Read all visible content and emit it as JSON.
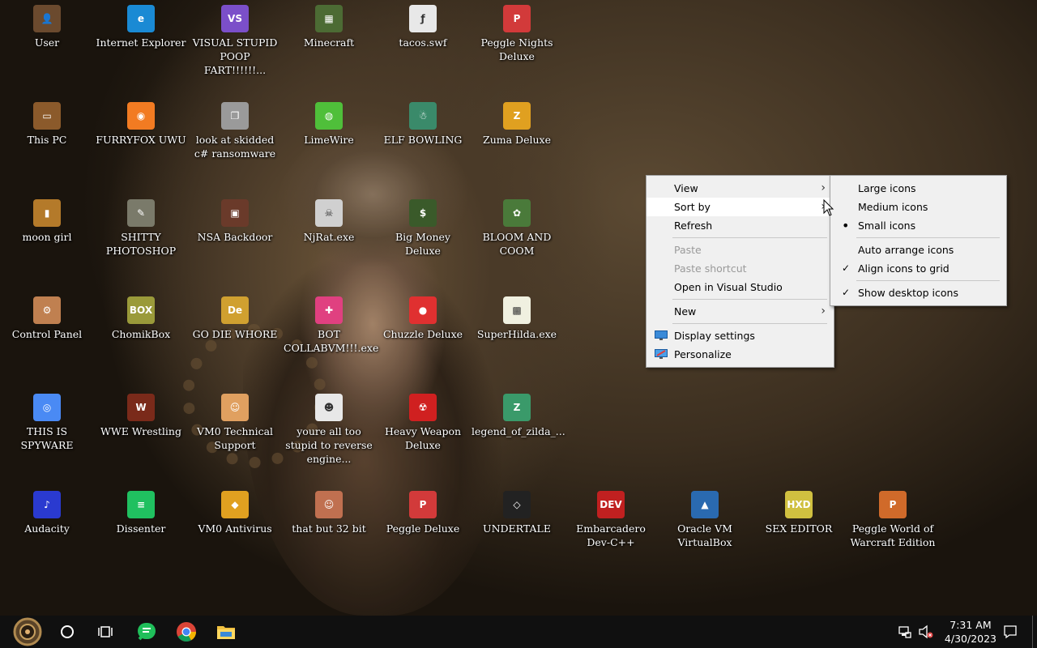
{
  "desktop": {
    "icons": [
      {
        "label": "User",
        "icon": "user-folder-icon",
        "color": "#6b4a2e"
      },
      {
        "label": "Internet Explorer",
        "icon": "edge-icon",
        "color": "#1a8ad4"
      },
      {
        "label": "VISUAL STUPID POOP FART!!!!!!...",
        "icon": "visual-studio-icon",
        "color": "#7b4fc9"
      },
      {
        "label": "Minecraft",
        "icon": "minecraft-icon",
        "color": "#4c6b34"
      },
      {
        "label": "tacos.swf",
        "icon": "flash-file-icon",
        "color": "#e8e8e8"
      },
      {
        "label": "Peggle Nights Deluxe",
        "icon": "peggle-icon",
        "color": "#d23a3a"
      },
      {
        "label": "This PC",
        "icon": "computer-icon",
        "color": "#8b5a2b"
      },
      {
        "label": "FURRYFOX UWU",
        "icon": "firefox-icon",
        "color": "#f27b22"
      },
      {
        "label": "look at skidded c# ransomware",
        "icon": "files-icon",
        "color": "#9a9a9a"
      },
      {
        "label": "LimeWire",
        "icon": "limewire-icon",
        "color": "#4fbf3a"
      },
      {
        "label": "ELF BOWLING",
        "icon": "elf-icon",
        "color": "#3a8a6a"
      },
      {
        "label": "Zuma Deluxe",
        "icon": "zuma-icon",
        "color": "#e0a020"
      },
      {
        "label": "moon girl",
        "icon": "folder-icon",
        "color": "#b47a2a"
      },
      {
        "label": "SHITTY PHOTOSHOP",
        "icon": "gimp-icon",
        "color": "#7a7a6a"
      },
      {
        "label": "NSA Backdoor",
        "icon": "picture-icon",
        "color": "#6a3a2a"
      },
      {
        "label": "NjRat.exe",
        "icon": "skull-icon",
        "color": "#d0d0d0"
      },
      {
        "label": "Big Money Deluxe",
        "icon": "money-icon",
        "color": "#3a5a2a"
      },
      {
        "label": "BLOOM AND COOM",
        "icon": "flower-icon",
        "color": "#4a7a3a"
      },
      {
        "label": "Control Panel",
        "icon": "control-panel-icon",
        "color": "#c08050"
      },
      {
        "label": "ChomikBox",
        "icon": "chomikbox-icon",
        "color": "#9a9a3a"
      },
      {
        "label": "GO DIE WHORE",
        "icon": "de-icon",
        "color": "#d0a030"
      },
      {
        "label": "BOT COLLABVM!!!.exe",
        "icon": "bot-icon",
        "color": "#e04080"
      },
      {
        "label": "Chuzzle Deluxe",
        "icon": "chuzzle-icon",
        "color": "#e03030"
      },
      {
        "label": "SuperHilda.exe",
        "icon": "hilda-icon",
        "color": "#f0f0e0"
      },
      {
        "label": "THIS IS SPYWARE",
        "icon": "chrome-icon",
        "color": "#4a8af4"
      },
      {
        "label": "WWE Wrestling",
        "icon": "wrestling-icon",
        "color": "#7a2a1a"
      },
      {
        "label": "VM0 Technical Support",
        "icon": "support-icon",
        "color": "#e0a060"
      },
      {
        "label": "youre all too stupid to reverse engine...",
        "icon": "face-icon",
        "color": "#e8e8e8"
      },
      {
        "label": "Heavy Weapon Deluxe",
        "icon": "radiation-icon",
        "color": "#d02020"
      },
      {
        "label": "legend_of_zilda_...",
        "icon": "zelda-icon",
        "color": "#3a9a6a"
      },
      {
        "label": "Audacity",
        "icon": "audacity-icon",
        "color": "#2a3ad0"
      },
      {
        "label": "Dissenter",
        "icon": "dissenter-icon",
        "color": "#20c060"
      },
      {
        "label": "VM0 Antivirus",
        "icon": "shield-icon",
        "color": "#e0a020"
      },
      {
        "label": "that but 32 bit",
        "icon": "portrait-icon",
        "color": "#c07050"
      },
      {
        "label": "Peggle Deluxe",
        "icon": "peggle-deluxe-icon",
        "color": "#d23a3a"
      },
      {
        "label": "UNDERTALE",
        "icon": "unity-icon",
        "color": "#222222"
      },
      {
        "label": "Embarcadero Dev-C++",
        "icon": "devcpp-icon",
        "color": "#c02020"
      },
      {
        "label": "Oracle VM VirtualBox",
        "icon": "virtualbox-icon",
        "color": "#2a6ab0"
      },
      {
        "label": "SEX EDITOR",
        "icon": "hex-editor-icon",
        "color": "#d0c040"
      },
      {
        "label": "Peggle World of Warcraft Edition",
        "icon": "peggle-wow-icon",
        "color": "#d06a2a"
      }
    ]
  },
  "context_menu": {
    "items": [
      {
        "label": "View",
        "submenu": true,
        "disabled": false
      },
      {
        "label": "Sort by",
        "submenu": true,
        "disabled": false,
        "hover": true
      },
      {
        "label": "Refresh",
        "submenu": false,
        "disabled": false
      },
      {
        "label": "Paste",
        "submenu": false,
        "disabled": true
      },
      {
        "label": "Paste shortcut",
        "submenu": false,
        "disabled": true
      },
      {
        "label": "Open in Visual Studio",
        "submenu": false,
        "disabled": false
      },
      {
        "label": "New",
        "submenu": true,
        "disabled": false
      },
      {
        "label": "Display settings",
        "submenu": false,
        "disabled": false,
        "icon": "display-settings-icon"
      },
      {
        "label": "Personalize",
        "submenu": false,
        "disabled": false,
        "icon": "personalize-icon"
      }
    ]
  },
  "view_submenu": {
    "items": [
      {
        "label": "Large icons",
        "mark": ""
      },
      {
        "label": "Medium icons",
        "mark": ""
      },
      {
        "label": "Small icons",
        "mark": "•"
      },
      {
        "label": "Auto arrange icons",
        "mark": ""
      },
      {
        "label": "Align icons to grid",
        "mark": "✓"
      },
      {
        "label": "Show desktop icons",
        "mark": "✓"
      }
    ]
  },
  "taskbar": {
    "time": "7:31 AM",
    "date": "4/30/2023",
    "buttons": [
      "start-button-icon",
      "cortana-icon",
      "task-view-icon",
      "dissenter-icon",
      "chrome-icon",
      "file-explorer-icon"
    ]
  }
}
